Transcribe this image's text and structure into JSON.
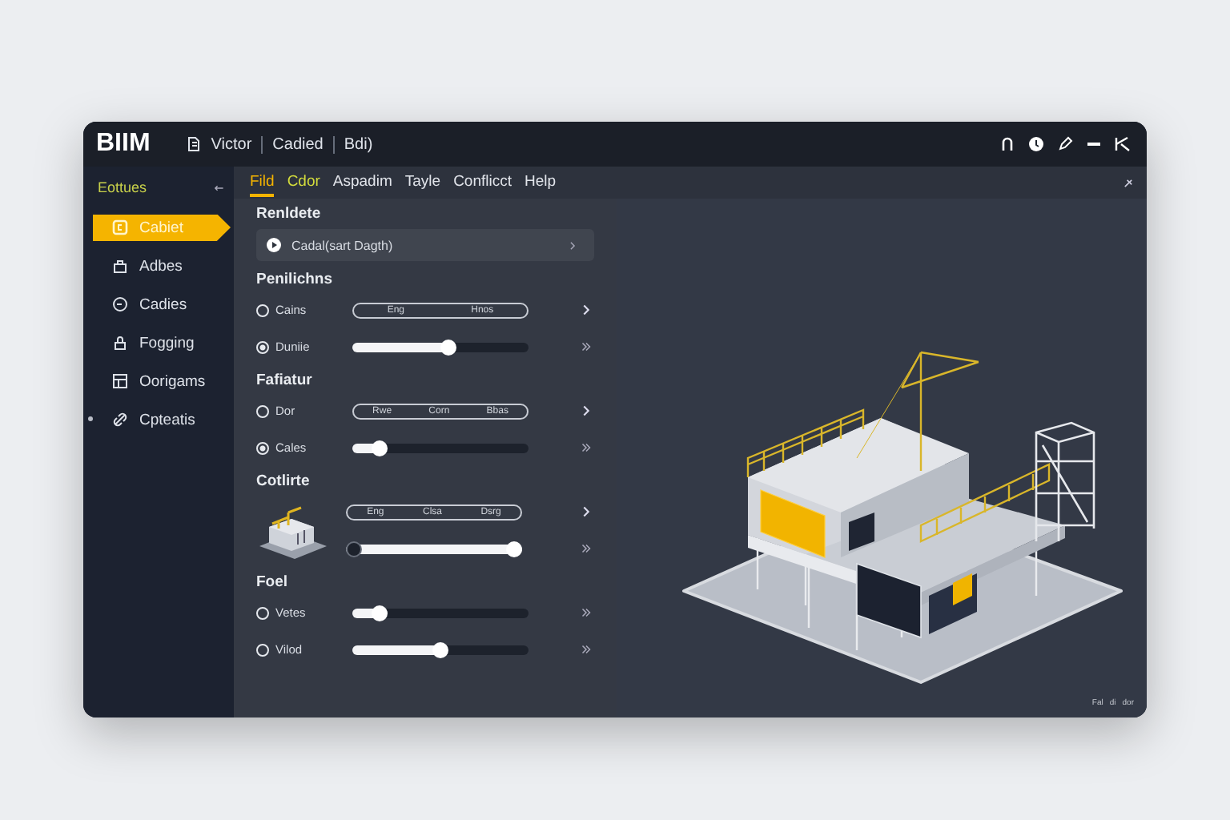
{
  "window": {
    "logo": "BIIM",
    "menu": [
      "Victor",
      "Cadied",
      "Bdi)"
    ]
  },
  "sidebar": {
    "header": "Eottues",
    "items": [
      {
        "label": "Cabiet",
        "selected": true,
        "marked": false
      },
      {
        "label": "Adbes",
        "selected": false,
        "marked": false
      },
      {
        "label": "Cadies",
        "selected": false,
        "marked": false
      },
      {
        "label": "Fogging",
        "selected": false,
        "marked": false
      },
      {
        "label": "Oorigams",
        "selected": false,
        "marked": false
      },
      {
        "label": "Cpteatis",
        "selected": false,
        "marked": true
      }
    ]
  },
  "tabs": [
    {
      "label": "Fild",
      "selected": true,
      "highlighted": false
    },
    {
      "label": "Cdor",
      "selected": false,
      "highlighted": true
    },
    {
      "label": "Aspadim",
      "selected": false,
      "highlighted": false
    },
    {
      "label": "Tayle",
      "selected": false,
      "highlighted": false
    },
    {
      "label": "Conflicct",
      "selected": false,
      "highlighted": false
    },
    {
      "label": "Help",
      "selected": false,
      "highlighted": false
    }
  ],
  "panel": {
    "sections": [
      {
        "title": "Renldete",
        "thumbnail": false,
        "rows": [
          {
            "kind": "dropdown",
            "value": "Cadal(sart Dagth)"
          }
        ]
      },
      {
        "title": "Penilichns",
        "thumbnail": false,
        "rows": [
          {
            "kind": "segments",
            "label": "Cains",
            "checked": false,
            "segments": [
              "Eng",
              "Hnos"
            ]
          },
          {
            "kind": "slider",
            "label": "Duniie",
            "checked": true,
            "level": 0.55
          }
        ]
      },
      {
        "title": "Fafiatur",
        "thumbnail": false,
        "rows": [
          {
            "kind": "segments",
            "label": "Dor",
            "checked": false,
            "segments": [
              "Rwe",
              "Corn",
              "Bbas"
            ]
          },
          {
            "kind": "slider",
            "label": "Cales",
            "checked": true,
            "level": 0.12
          }
        ]
      },
      {
        "title": "Cotlirte",
        "thumbnail": true,
        "rows": [
          {
            "kind": "segments",
            "segments": [
              "Eng",
              "Clsa",
              "Dsrg"
            ]
          },
          {
            "kind": "slider",
            "level": 1
          }
        ]
      },
      {
        "title": "Foel",
        "thumbnail": false,
        "rows": [
          {
            "kind": "slider",
            "label": "Vetes",
            "checked": false,
            "level": 0.12
          },
          {
            "kind": "slider",
            "label": "Vilod",
            "checked": false,
            "level": 0.5
          }
        ]
      }
    ]
  },
  "viewport": {
    "status": [
      "Fal",
      "di",
      "dor"
    ]
  }
}
